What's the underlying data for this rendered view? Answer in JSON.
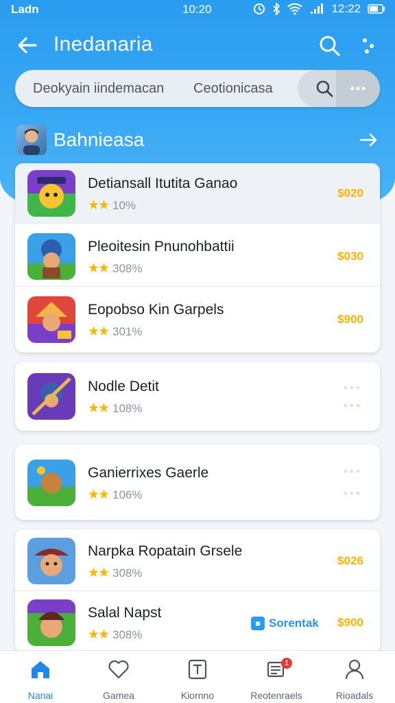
{
  "status_bar": {
    "carrier": "Ladn",
    "time": "10:20",
    "battery": "12:22"
  },
  "app_bar": {
    "title": "Inedanaria"
  },
  "search": {
    "placeholder_left": "Deokyain iindemacan",
    "placeholder_right": "Ceotionicasa"
  },
  "section": {
    "title": "Bahnieasa"
  },
  "games_group_1": [
    {
      "name": "Detiansall Itutita Ganao",
      "stars": "★★",
      "rating": "10%",
      "price": "$020"
    },
    {
      "name": "Pleoitesin Pnunohbattii",
      "stars": "★★",
      "rating": "308%",
      "price": "$030"
    },
    {
      "name": "Eopobso Kin Garpels",
      "stars": "★★",
      "rating": "301%",
      "price": "$900"
    }
  ],
  "games_single_1": {
    "name": "Nodle Detit",
    "stars": "★★",
    "rating": "108%"
  },
  "games_single_2": {
    "name": "Ganierrixes Gaerle",
    "stars": "★★",
    "rating": "106%"
  },
  "games_group_2": [
    {
      "name": "Narpka Ropatain Grsele",
      "stars": "★★",
      "rating": "308%",
      "price": "$026"
    },
    {
      "name": "Salal Napst",
      "stars": "★★",
      "rating": "308%",
      "price": "$900",
      "badge": "Sorentak"
    }
  ],
  "bottom_nav": [
    {
      "label": "Nanai",
      "icon": "home-icon"
    },
    {
      "label": "Gamea",
      "icon": "heart-icon"
    },
    {
      "label": "Kiornno",
      "icon": "text-box-icon"
    },
    {
      "label": "Reotenraels",
      "icon": "inbox-icon",
      "notification": "1"
    },
    {
      "label": "Rioadals",
      "icon": "person-icon"
    }
  ],
  "colors": {
    "primary": "#2a9cf0",
    "price": "#f5b400",
    "star": "#f5b800",
    "active_nav": "#1f88e5"
  }
}
